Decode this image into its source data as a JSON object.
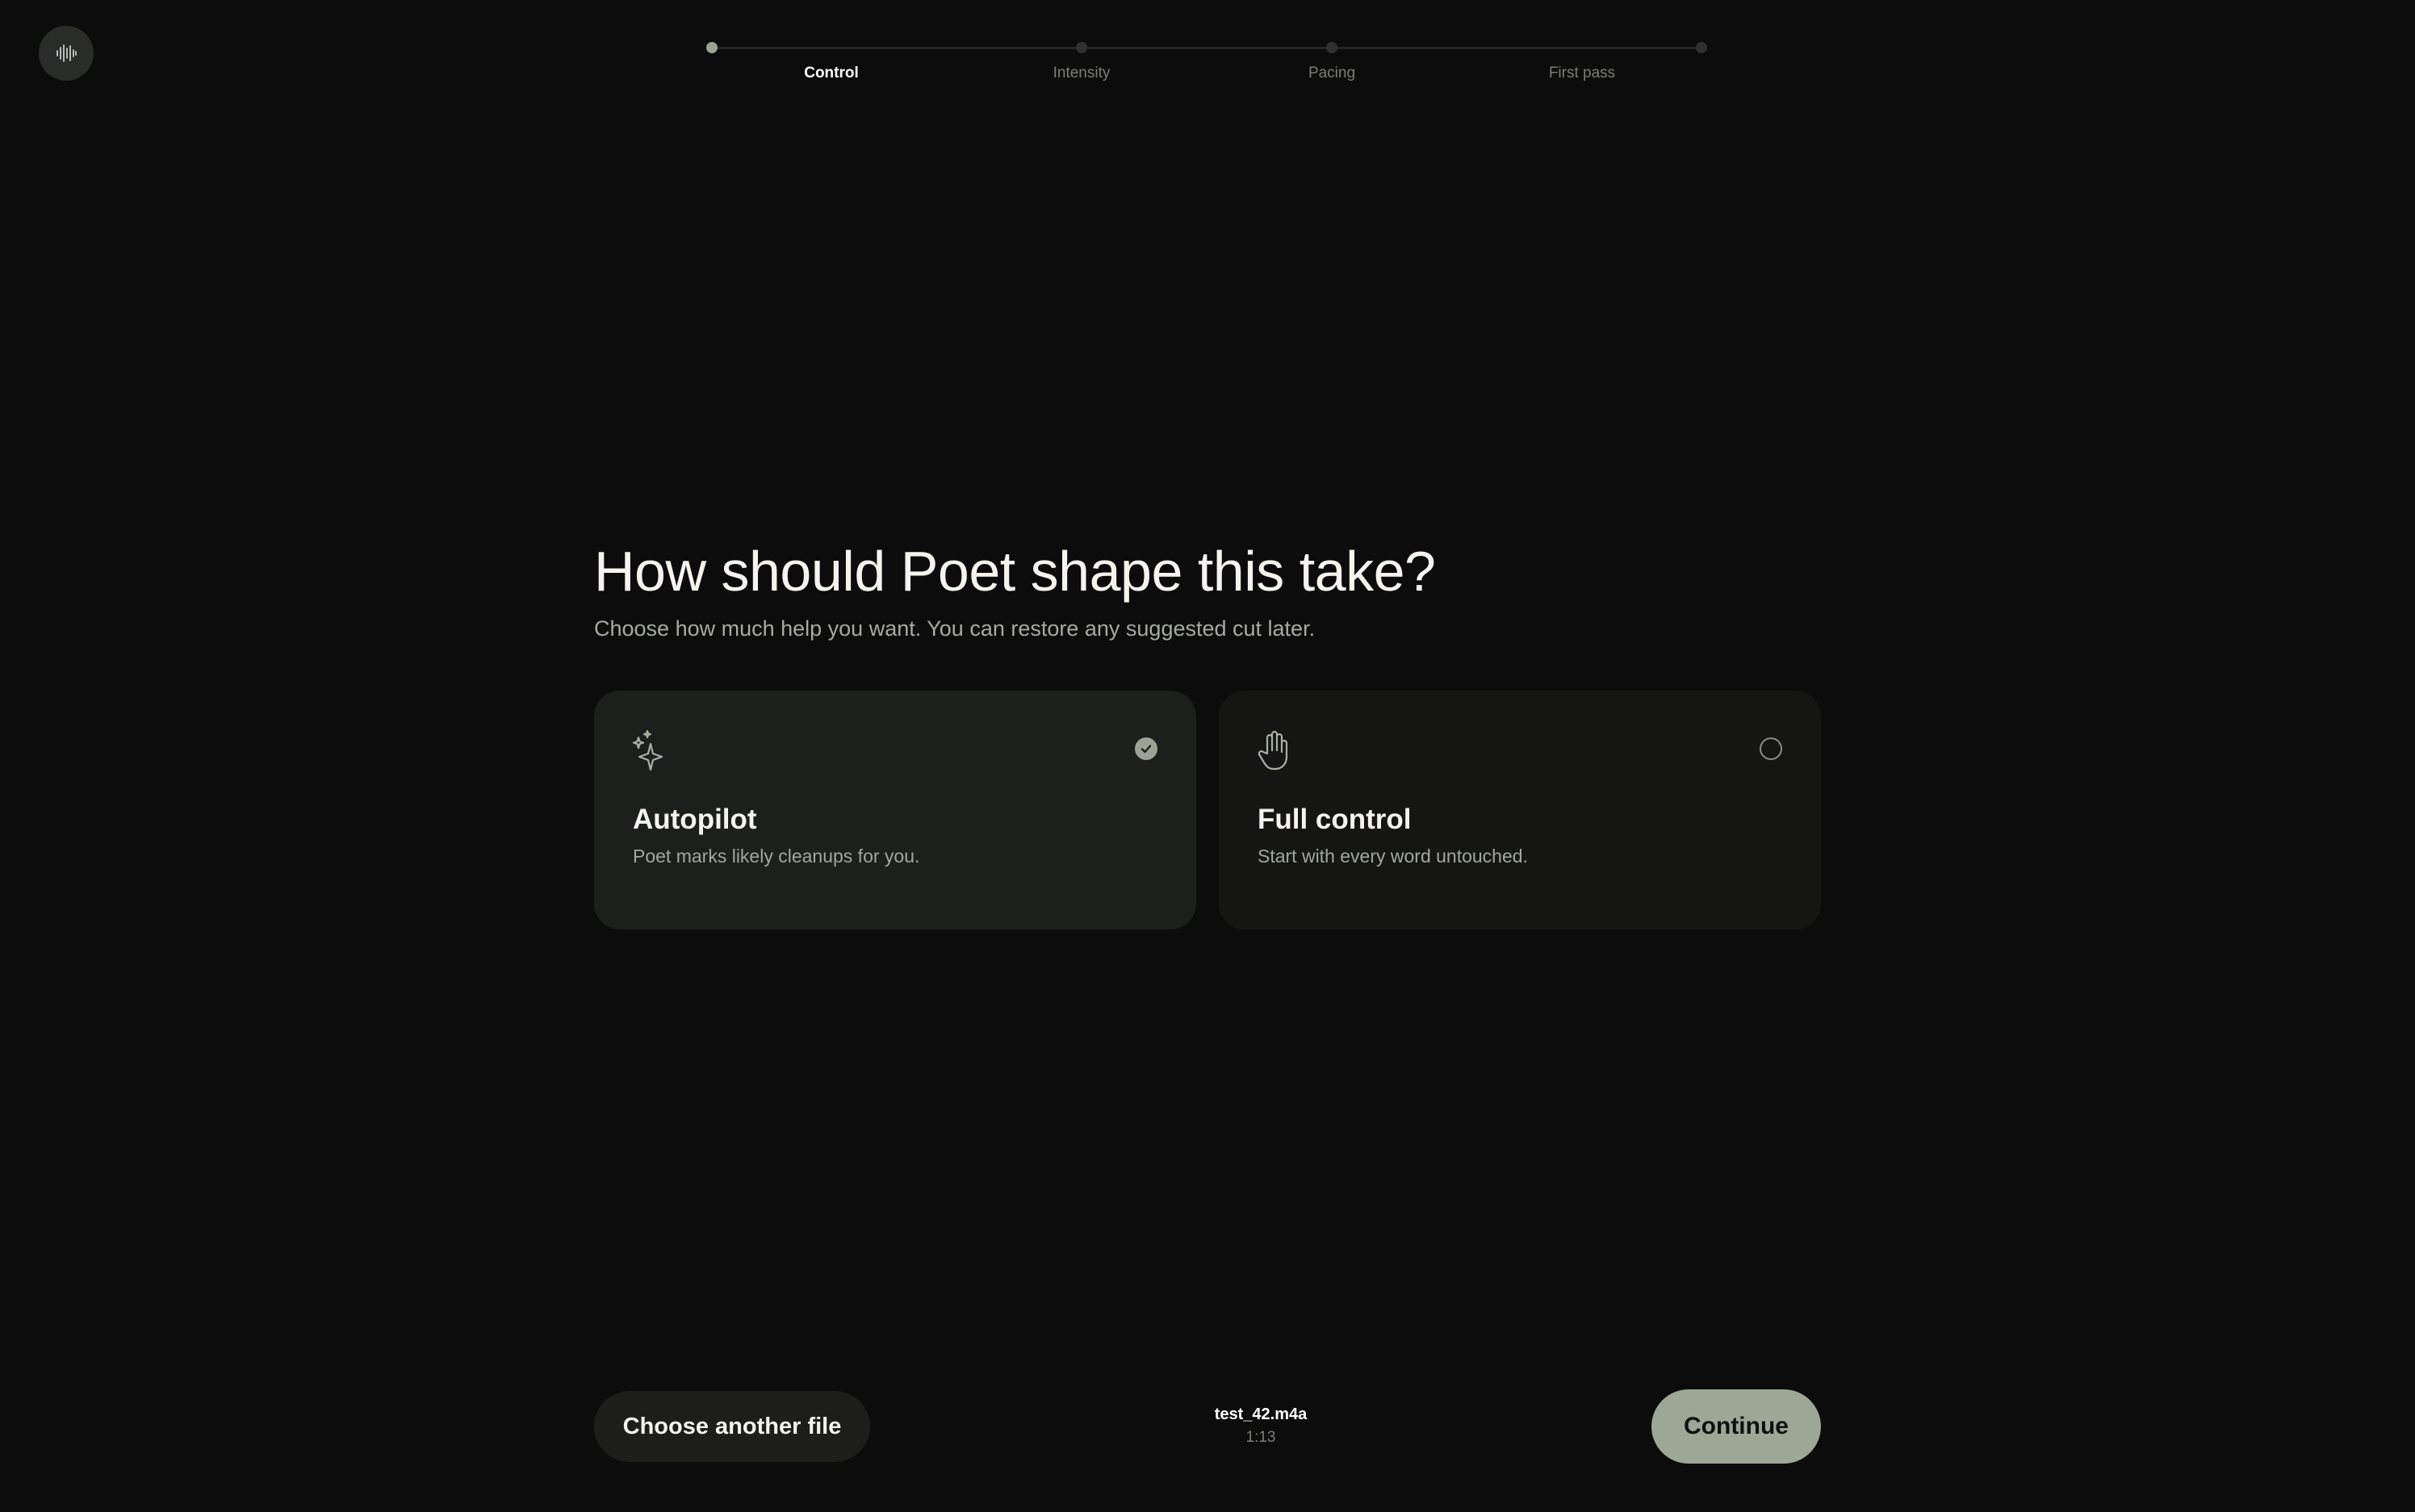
{
  "app": {
    "logo_icon": "waveform-icon"
  },
  "stepper": {
    "steps": [
      {
        "label": "Control",
        "active": true
      },
      {
        "label": "Intensity",
        "active": false
      },
      {
        "label": "Pacing",
        "active": false
      },
      {
        "label": "First pass",
        "active": false
      }
    ]
  },
  "main": {
    "title": "How should Poet shape this take?",
    "subtitle": "Choose how much help you want. You can restore any suggested cut later."
  },
  "options": [
    {
      "icon": "sparkles-icon",
      "title": "Autopilot",
      "description": "Poet marks likely cleanups for you.",
      "selected": true
    },
    {
      "icon": "hand-icon",
      "title": "Full control",
      "description": "Start with every word untouched.",
      "selected": false
    }
  ],
  "footer": {
    "back_label": "Choose another file",
    "file_name": "test_42.m4a",
    "file_duration": "1:13",
    "continue_label": "Continue"
  },
  "colors": {
    "background": "#0c0c0c",
    "accent": "#9ca796",
    "card_selected": "#1d1f1c",
    "card": "#151614"
  }
}
